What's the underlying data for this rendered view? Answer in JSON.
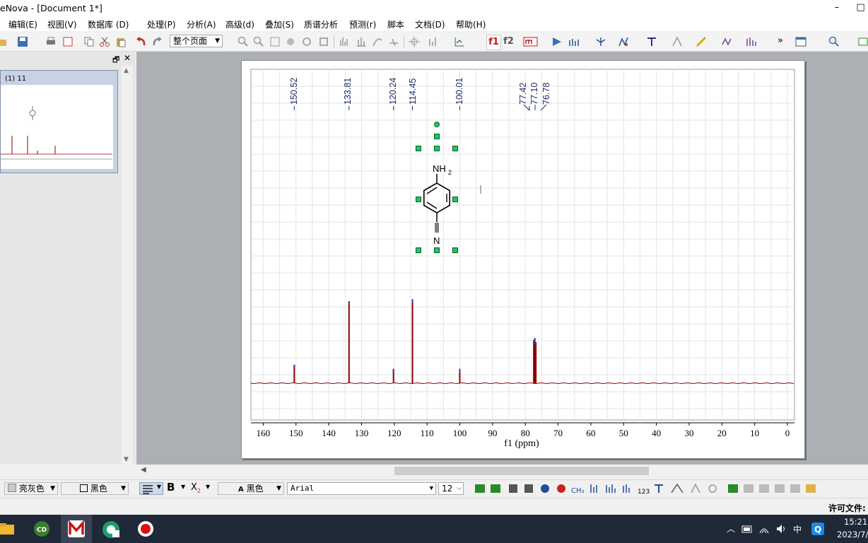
{
  "window": {
    "title": "eNova - [Document 1*]",
    "minimize": "–",
    "maximize": "□"
  },
  "menu": [
    "编辑(E)",
    "视图(V)",
    "数据库 (D)",
    "处理(P)",
    "分析(A)",
    "高级(d)",
    "叠加(S)",
    "质谱分析",
    "预测(r)",
    "脚本",
    "文档(D)",
    "帮助(H)"
  ],
  "toolbar": {
    "page_dropdown": "整个页面",
    "f1": "f1",
    "f2": "f2",
    "more": "»"
  },
  "leftpanel": {
    "thumb_label": "(1) 11",
    "float_icon": "🗗",
    "close_icon": "✕"
  },
  "spectrum": {
    "peak_labels": [
      "150.52",
      "133.81",
      "120.24",
      "114.45",
      "100.01",
      "77.42",
      "77.10",
      "76.78"
    ],
    "axis_ticks": [
      "160",
      "150",
      "140",
      "130",
      "120",
      "110",
      "100",
      "90",
      "80",
      "70",
      "60",
      "50",
      "40",
      "30",
      "20",
      "10",
      "0"
    ],
    "xlabel": "f1 (ppm)",
    "molecule": {
      "top_group": "NH",
      "top_sub": "2",
      "bottom_atom": "N"
    }
  },
  "format": {
    "fill_color": "亮灰色",
    "line_color": "黑色",
    "bold": "B",
    "sub": "X",
    "font_color": "黑色",
    "font": "Arial",
    "size": "12"
  },
  "status": {
    "license": "许可文件:"
  },
  "taskbar": {
    "time": "15:21",
    "date": "2023/7/",
    "ime": "中"
  },
  "colors": {
    "spectrum_line": "#8b0000",
    "peak_tip": "#2f3fb8",
    "handle": "#22c55e"
  }
}
